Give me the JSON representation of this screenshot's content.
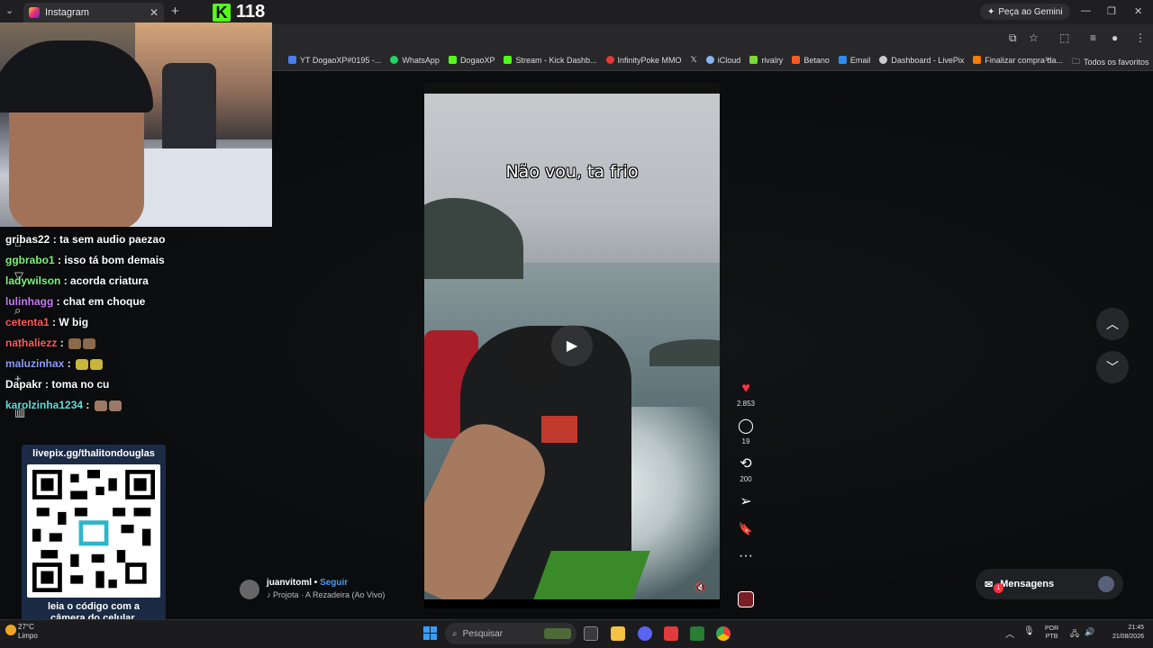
{
  "browser": {
    "tab_title": "Instagram",
    "tab_close": "✕",
    "new_tab": "+",
    "gemini_label": "Peça ao Gemini",
    "minimize": "—",
    "maximize": "❐",
    "close": "✕"
  },
  "kick_overlay": {
    "logo": "K",
    "count": "118"
  },
  "bookmarks": {
    "items": [
      {
        "label": "YT DogaoXP#0195 -...",
        "color": "#4a7cf0"
      },
      {
        "label": "WhatsApp",
        "color": "#25d366"
      },
      {
        "label": "DogaoXP",
        "color": "#53fc18"
      },
      {
        "label": "Stream - Kick Dashb...",
        "color": "#53fc18"
      },
      {
        "label": "InfinityPoke MMO",
        "color": "#e53935"
      },
      {
        "label": "𝕏",
        "color": "#000000"
      },
      {
        "label": "iCloud",
        "color": "#8ab4f8"
      },
      {
        "label": "rivalry",
        "color": "#7cd93c"
      },
      {
        "label": "Betano",
        "color": "#ff5a1f"
      },
      {
        "label": "Email",
        "color": "#2d8cf0"
      },
      {
        "label": "Dashboard - LivePix",
        "color": "#cccccc"
      },
      {
        "label": "Finalizar compra da...",
        "color": "#f57c00"
      }
    ],
    "more": "»",
    "favorites": "Todos os favoritos"
  },
  "chat": {
    "messages": [
      {
        "user": "gribas22",
        "text": ": ta sem audio paezao",
        "color": "#ffffff"
      },
      {
        "user": "ggbrabo1",
        "text": ": isso tá bom demais",
        "color": "#7cf57c"
      },
      {
        "user": "ladywilson",
        "text": ": acorda criatura",
        "color": "#7cf57c"
      },
      {
        "user": "lulinhagg",
        "text": ": chat em choque",
        "color": "#c77cf5"
      },
      {
        "user": "cetenta1",
        "text": ": W big",
        "color": "#ff5a5a"
      },
      {
        "user": "nathaliezz",
        "text": ":",
        "color": "#ff5a5a"
      },
      {
        "user": "maluzinhax",
        "text": ":",
        "color": "#8c9dff"
      },
      {
        "user": "Dapakr",
        "text": ": toma no cu",
        "color": "#ffffff"
      },
      {
        "user": "karolzinha1234",
        "text": ":",
        "color": "#5ee0e0"
      }
    ]
  },
  "livepix": {
    "url": "livepix.gg/thalitondouglas",
    "caption_line1": "leia o código com a",
    "caption_line2": "câmera do celular."
  },
  "reel": {
    "caption": "Não vou, ta frio",
    "play_icon": "▶",
    "mute_icon": "🔇"
  },
  "author": {
    "name": "juanvitoml",
    "separator": " • ",
    "follow": "Seguir",
    "audio": "♪ Projota · A Rezadeira (Ao Vivo)"
  },
  "actions": {
    "like_icon": "♥",
    "like_count": "2.853",
    "comment_icon": "◯",
    "comment_count": "19",
    "repost_icon": "⟲",
    "repost_count": "200",
    "share_icon": "➢",
    "save_icon": "🔖",
    "more_icon": "···"
  },
  "nav": {
    "up": "︿",
    "down": "﹀"
  },
  "messages": {
    "label": "Mensagens",
    "badge": "1",
    "icon": "✉"
  },
  "taskbar": {
    "weather_temp": "27°C",
    "weather_desc": "Limpo",
    "search_placeholder": "Pesquisar",
    "lang_line1": "POR",
    "lang_line2": "PTB",
    "time": "21:45",
    "date": "21/08/2026"
  }
}
